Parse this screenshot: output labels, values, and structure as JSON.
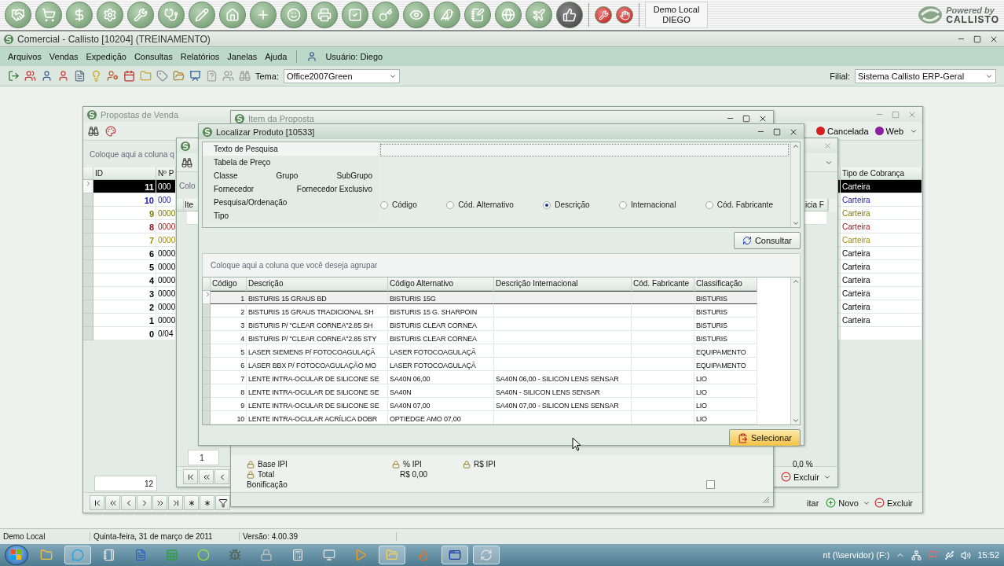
{
  "launcher": {
    "session": [
      "Demo Local",
      "DIEGO"
    ],
    "logo": {
      "tagline": "Powered by",
      "brand": "CALLISTO"
    }
  },
  "app": {
    "title": "Comercial - Callisto [10204] (TREINAMENTO)"
  },
  "menu": {
    "items": [
      "Arquivos",
      "Vendas",
      "Expedição",
      "Consultas",
      "Relatórios",
      "Janelas",
      "Ajuda"
    ],
    "user": "Usuário: Diego"
  },
  "toolbar": {
    "theme_label": "Tema:",
    "theme_value": "Office2007Green",
    "branch_label": "Filial:",
    "branch_value": "Sistema Callisto ERP-Geral"
  },
  "propostas": {
    "title": "Propostas de Venda",
    "legend": [
      {
        "label": "Cancelada",
        "color": "#d42020"
      },
      {
        "label": "Web",
        "color": "#8a1fa0"
      }
    ],
    "group_hint": "Coloque aqui a coluna q",
    "columns": [
      "ID",
      "Nº P",
      "Tipo de Cobrança"
    ],
    "rows": [
      {
        "id": "11",
        "numero": "000",
        "tipo": "Carteira",
        "selected": true
      },
      {
        "id": "10",
        "numero": "000",
        "tipo": "Carteira",
        "color": "#1a1ab4",
        "selected": false
      },
      {
        "id": "9",
        "numero": "0000",
        "tipo": "Carteira",
        "color": "#7a7a00",
        "selected": false
      },
      {
        "id": "8",
        "numero": "0000",
        "tipo": "Carteira",
        "color": "#9a1010",
        "selected": false
      },
      {
        "id": "7",
        "numero": "0000",
        "tipo": "Carteira",
        "color": "#a08c00",
        "selected": false
      },
      {
        "id": "6",
        "numero": "0000",
        "tipo": "Carteira",
        "color": "#000000",
        "selected": false
      },
      {
        "id": "5",
        "numero": "0000",
        "tipo": "Carteira",
        "color": "#000000",
        "selected": false
      },
      {
        "id": "4",
        "numero": "0000",
        "tipo": "Carteira",
        "color": "#000000",
        "selected": false
      },
      {
        "id": "3",
        "numero": "0000",
        "tipo": "Carteira",
        "color": "#000000",
        "selected": false
      },
      {
        "id": "2",
        "numero": "0000",
        "tipo": "Carteira",
        "color": "#000000",
        "selected": false
      },
      {
        "id": "1",
        "numero": "0000",
        "tipo": "Carteira",
        "color": "#000000",
        "selected": false
      },
      {
        "id": "0",
        "numero": "0/04",
        "color": "#000000",
        "selected": false
      }
    ],
    "footer": "12",
    "actions": [
      "itar",
      "Novo",
      "Excluir"
    ]
  },
  "item_window": {
    "group_hint": "Colo",
    "columns": [
      "Ite",
      "icia F"
    ],
    "footer": "1",
    "action": "Excluir"
  },
  "item_proposta": {
    "title": "Item da Proposta",
    "fields": [
      {
        "label": "Base IPI"
      },
      {
        "label": "% IPI"
      },
      {
        "label": "R$ IPI"
      }
    ],
    "ipi_value": "0,0 %",
    "total": {
      "label": "Total",
      "value": "R$ 0,00"
    },
    "bonificacao": {
      "label": "Bonificação",
      "checked": false
    }
  },
  "localizar": {
    "title": "Localizar Produto [10533]",
    "filter_rows": [
      [
        "Texto de Pesquisa"
      ],
      [
        "Tabela de Preço"
      ],
      [
        "Classe",
        "Grupo",
        "SubGrupo"
      ],
      [
        "Fornecedor",
        "Fornecedor Exclusivo"
      ],
      [
        "Pesquisa/Ordenação"
      ],
      [
        "Tipo"
      ]
    ],
    "sort_options": [
      {
        "label": "Código",
        "selected": false
      },
      {
        "label": "Cód. Alternativo",
        "selected": false
      },
      {
        "label": "Descrição",
        "selected": true
      },
      {
        "label": "Internacional",
        "selected": false
      },
      {
        "label": "Cód. Fabricante",
        "selected": false
      }
    ],
    "search_button": "Consultar",
    "group_hint": "Coloque aqui a coluna que você deseja agrupar",
    "columns": [
      "Código",
      "Descrição",
      "Código Alternativo",
      "Descrição Internacional",
      "Cód. Fabricante",
      "Classificação"
    ],
    "rows": [
      {
        "codigo": "1",
        "descricao": "BISTURIS 15 GRAUS BD",
        "alternativo": "BISTURIS 15G",
        "classificacao": "BISTURIS",
        "selected": true
      },
      {
        "codigo": "2",
        "descricao": "BISTURIS 15 GRAUS TRADICIONAL SH",
        "alternativo": "BISTURIS 15 G. SHARPOIN",
        "classificacao": "BISTURIS",
        "selected": false
      },
      {
        "codigo": "3",
        "descricao": "BISTURIS P/ \"CLEAR CORNEA\"2.85 SH",
        "alternativo": "BISTURIS CLEAR CORNEA",
        "classificacao": "BISTURIS",
        "selected": false
      },
      {
        "codigo": "4",
        "descricao": "BISTURIS P/ \"CLEAR CORNEA\"2.85 STY",
        "alternativo": "BISTURIS CLEAR CORNEA",
        "classificacao": "BISTURIS",
        "selected": false
      },
      {
        "codigo": "5",
        "descricao": "LASER SIEMENS P/ FOTOCOAGULAÇÃ",
        "alternativo": "LASER FOTOCOAGULAÇÃ",
        "classificacao": "EQUIPAMENTO",
        "selected": false
      },
      {
        "codigo": "6",
        "descricao": "LASER BBX P/ FOTOCOAGULAÇÃO MO",
        "alternativo": "LASER FOTOCOAGULAÇÃ",
        "classificacao": "EQUIPAMENTO",
        "selected": false
      },
      {
        "codigo": "7",
        "descricao": "LENTE INTRA-OCULAR DE SILICONE SE",
        "alternativo": "SA40N 06,00",
        "internacional": "SA40N 06,00 - SILICON LENS SENSAR",
        "classificacao": "LIO",
        "selected": false
      },
      {
        "codigo": "8",
        "descricao": "LENTE INTRA-OCULAR DE SILICONE SE",
        "alternativo": "SA40N",
        "internacional": "SA40N - SILICON LENS SENSAR",
        "classificacao": "LIO",
        "selected": false
      },
      {
        "codigo": "9",
        "descricao": "LENTE INTRA-OCULAR DE SILICONE SE",
        "alternativo": "SA40N 07,00",
        "internacional": "SA40N 07,00 - SILICON LENS SENSAR",
        "classificacao": "LIO",
        "selected": false
      },
      {
        "codigo": "10",
        "descricao": "LENTE INTRA-OCULAR ACRÍLICA DOBR",
        "alternativo": "OPTIEDGE AMO 07,00",
        "classificacao": "LIO",
        "selected": false
      }
    ],
    "select_button": "Selecionar"
  },
  "status_bar": [
    "Demo Local",
    "Quinta-feira, 31 de março de 2011",
    "Versão: 4.00.39"
  ],
  "taskbar": {
    "drive": "nt (\\\\servidor) (F:)",
    "clock": "15:52"
  }
}
